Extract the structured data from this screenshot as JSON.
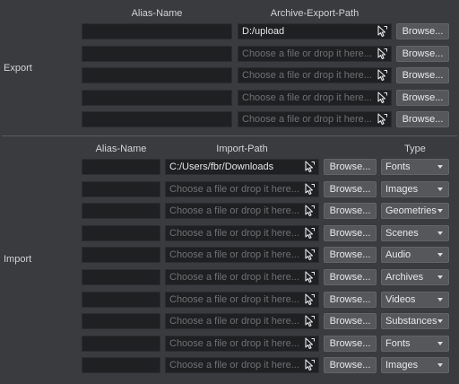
{
  "export": {
    "section_label": "Export",
    "headers": {
      "alias": "Alias-Name",
      "path": "Archive-Export-Path"
    },
    "browse_label": "Browse...",
    "rows": [
      {
        "alias": "",
        "path": "D:/upload",
        "placeholder": "Choose a file or drop it here..."
      },
      {
        "alias": "",
        "path": "",
        "placeholder": "Choose a file or drop it here..."
      },
      {
        "alias": "",
        "path": "",
        "placeholder": "Choose a file or drop it here..."
      },
      {
        "alias": "",
        "path": "",
        "placeholder": "Choose a file or drop it here..."
      },
      {
        "alias": "",
        "path": "",
        "placeholder": "Choose a file or drop it here..."
      }
    ]
  },
  "import": {
    "section_label": "Import",
    "headers": {
      "alias": "Alias-Name",
      "path": "Import-Path",
      "type": "Type"
    },
    "browse_label": "Browse...",
    "rows": [
      {
        "alias": "",
        "path": "C:/Users/fbr/Downloads",
        "placeholder": "Choose a file or drop it here...",
        "type": "Fonts"
      },
      {
        "alias": "",
        "path": "",
        "placeholder": "Choose a file or drop it here...",
        "type": "Images"
      },
      {
        "alias": "",
        "path": "",
        "placeholder": "Choose a file or drop it here...",
        "type": "Geometries"
      },
      {
        "alias": "",
        "path": "",
        "placeholder": "Choose a file or drop it here...",
        "type": "Scenes"
      },
      {
        "alias": "",
        "path": "",
        "placeholder": "Choose a file or drop it here...",
        "type": "Audio"
      },
      {
        "alias": "",
        "path": "",
        "placeholder": "Choose a file or drop it here...",
        "type": "Archives"
      },
      {
        "alias": "",
        "path": "",
        "placeholder": "Choose a file or drop it here...",
        "type": "Videos"
      },
      {
        "alias": "",
        "path": "",
        "placeholder": "Choose a file or drop it here...",
        "type": "Substances"
      },
      {
        "alias": "",
        "path": "",
        "placeholder": "Choose a file or drop it here...",
        "type": "Fonts"
      },
      {
        "alias": "",
        "path": "",
        "placeholder": "Choose a file or drop it here...",
        "type": "Images"
      }
    ]
  },
  "icons": {
    "picker": "file-picker-cursor-icon",
    "dropdown": "chevron-down-icon"
  },
  "colors": {
    "background": "#3a3b3e",
    "field": "#1f2022",
    "button": "#55575b",
    "text": "#c9cacc"
  }
}
